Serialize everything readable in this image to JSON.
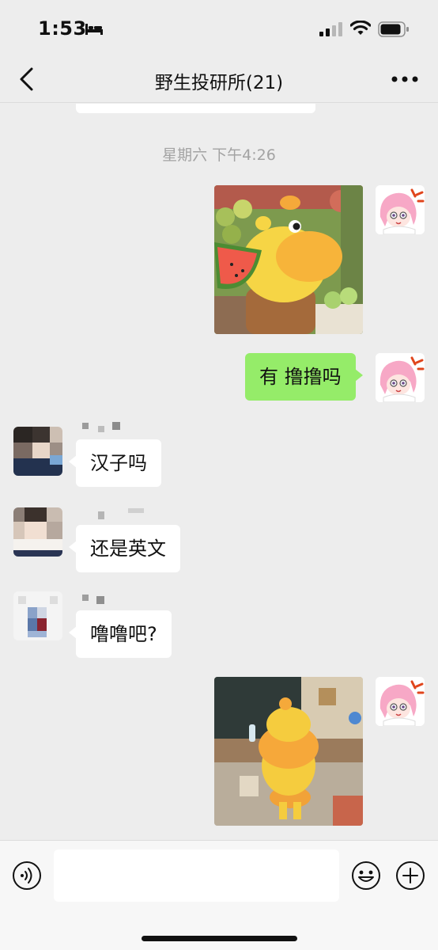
{
  "status_bar": {
    "time": "1:53",
    "icons": [
      "bed-icon",
      "signal-icon",
      "wifi-icon",
      "battery-icon"
    ]
  },
  "nav": {
    "title": "野生投研所(21)",
    "back_icon": "chevron-left-icon",
    "more_icon": "more-dots-icon"
  },
  "chat": {
    "timestamp": "星期六 下午4:26",
    "messages": [
      {
        "sender": "self",
        "type": "sticker",
        "description": "yellow duck holding watermelon"
      },
      {
        "sender": "self",
        "type": "text",
        "text": "有 撸撸吗"
      },
      {
        "sender": "other",
        "type": "text",
        "text": "汉子吗"
      },
      {
        "sender": "other",
        "type": "text",
        "text": "还是英文"
      },
      {
        "sender": "other",
        "type": "text",
        "text": "噜噜吧?"
      },
      {
        "sender": "self",
        "type": "sticker",
        "description": "yellow duck dancing in classroom"
      }
    ]
  },
  "input_bar": {
    "placeholder": "",
    "icons": [
      "voice-icon",
      "emoji-icon",
      "plus-icon"
    ]
  },
  "colors": {
    "background": "#ededed",
    "self_bubble": "#95ec69",
    "other_bubble": "#ffffff",
    "timestamp_text": "#a3a3a3"
  }
}
